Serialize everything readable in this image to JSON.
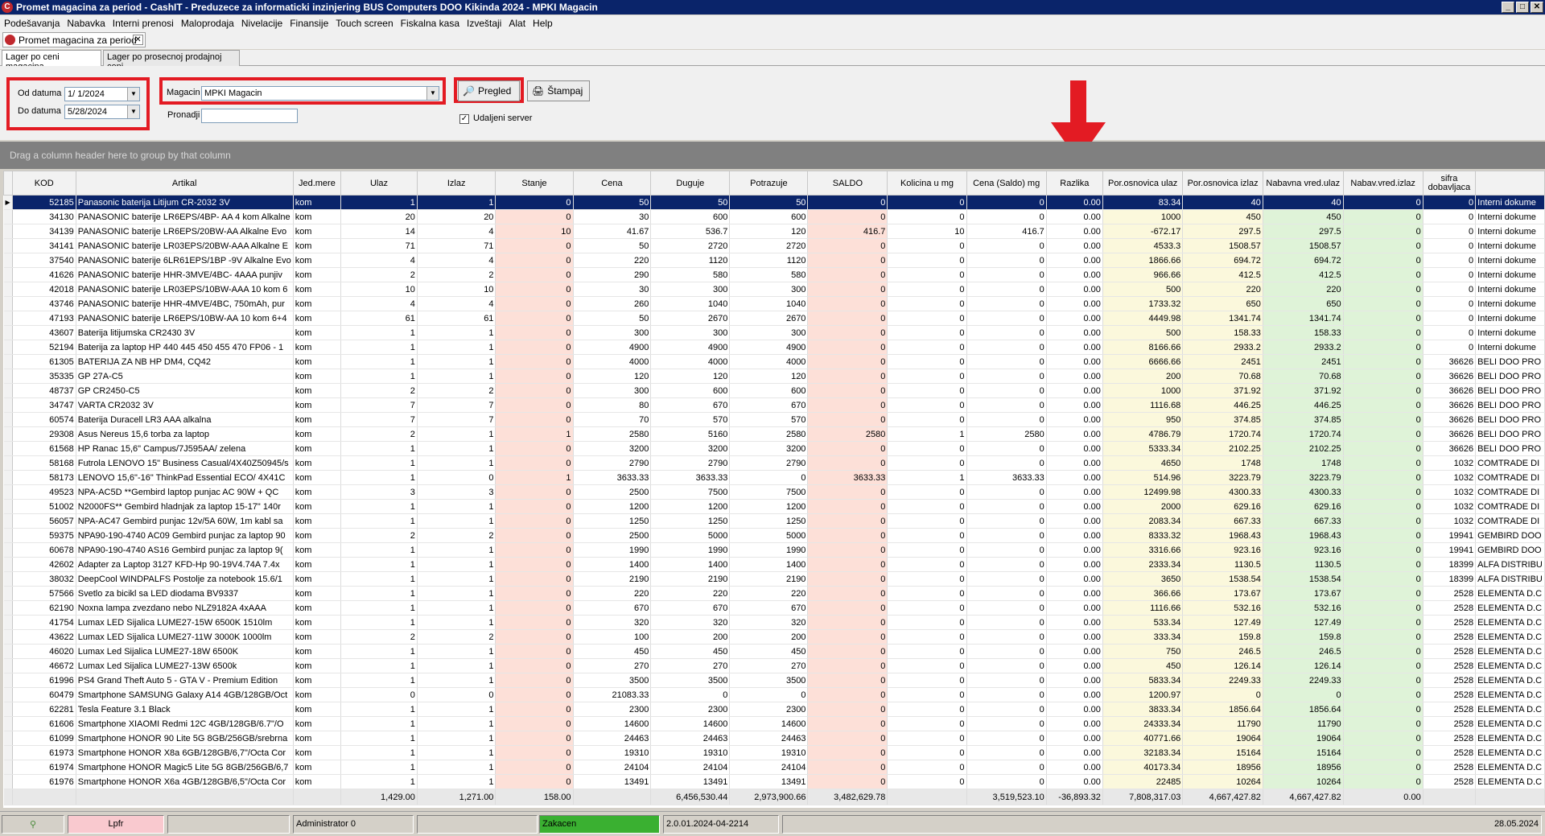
{
  "window": {
    "title": "Promet magacina za period - CashIT - Preduzece za informaticki inzinjering BUS Computers DOO Kikinda 2024 - MPKI Magacin"
  },
  "menu": [
    "Podešavanja",
    "Nabavka",
    "Interni prenosi",
    "Maloprodaja",
    "Nivelacije",
    "Finansije",
    "Touch screen",
    "Fiskalna kasa",
    "Izveštaji",
    "Alat",
    "Help"
  ],
  "doc_tab": {
    "label": "Promet magacina za period"
  },
  "sub_tabs": [
    "Lager po ceni magacina",
    "Lager po prosecnoj prodajnoj ceni"
  ],
  "filters": {
    "od_label": "Od datuma",
    "od_value": "1/  1/2024",
    "do_label": "Do datuma",
    "do_value": "5/28/2024",
    "magacin_label": "Magacin",
    "magacin_value": "MPKI Magacin",
    "pronadji_label": "Pronadji",
    "pronadji_value": "",
    "pregled_label": "Pregled",
    "stampaj_label": "Štampaj",
    "udaljeni_label": "Udaljeni server",
    "udaljeni_checked": true
  },
  "group_hint": "Drag a column header here to group by that column",
  "columns": [
    "KOD",
    "Artikal",
    "Jed.mere",
    "Ulaz",
    "Izlaz",
    "Stanje",
    "Cena",
    "Duguje",
    "Potrazuje",
    "SALDO",
    "Kolicina u mg",
    "Cena (Saldo) mg",
    "Razlika",
    "Por.osnovica ulaz",
    "Por.osnovica izlaz",
    "Nabavna vred.ulaz",
    "Nabav.vred.izlaz",
    "sifra dobavljaca",
    ""
  ],
  "rows": [
    [
      "52185",
      "Panasonic baterija Litijum CR-2032 3V",
      "kom",
      "1",
      "1",
      "0",
      "50",
      "50",
      "50",
      "0",
      "0",
      "0",
      "0.00",
      "83.34",
      "40",
      "40",
      "0",
      "0",
      "Interni dokume"
    ],
    [
      "34130",
      "PANASONIC baterije LR6EPS/4BP- AA 4 kom Alkalne",
      "kom",
      "20",
      "20",
      "0",
      "30",
      "600",
      "600",
      "0",
      "0",
      "0",
      "0.00",
      "1000",
      "450",
      "450",
      "0",
      "0",
      "Interni dokume"
    ],
    [
      "34139",
      "PANASONIC baterije LR6EPS/20BW-AA  Alkalne Evo",
      "kom",
      "14",
      "4",
      "10",
      "41.67",
      "536.7",
      "120",
      "416.7",
      "10",
      "416.7",
      "0.00",
      "-672.17",
      "297.5",
      "297.5",
      "0",
      "0",
      "Interni dokume"
    ],
    [
      "34141",
      "PANASONIC baterije LR03EPS/20BW-AAA  Alkalne E",
      "kom",
      "71",
      "71",
      "0",
      "50",
      "2720",
      "2720",
      "0",
      "0",
      "0",
      "0.00",
      "4533.3",
      "1508.57",
      "1508.57",
      "0",
      "0",
      "Interni dokume"
    ],
    [
      "37540",
      "PANASONIC baterije 6LR61EPS/1BP -9V Alkalne Evo",
      "kom",
      "4",
      "4",
      "0",
      "220",
      "1120",
      "1120",
      "0",
      "0",
      "0",
      "0.00",
      "1866.66",
      "694.72",
      "694.72",
      "0",
      "0",
      "Interni dokume"
    ],
    [
      "41626",
      "PANASONIC baterije HHR-3MVE/4BC- 4AAA punjiv",
      "kom",
      "2",
      "2",
      "0",
      "290",
      "580",
      "580",
      "0",
      "0",
      "0",
      "0.00",
      "966.66",
      "412.5",
      "412.5",
      "0",
      "0",
      "Interni dokume"
    ],
    [
      "42018",
      "PANASONIC baterije LR03EPS/10BW-AAA 10 kom 6",
      "kom",
      "10",
      "10",
      "0",
      "30",
      "300",
      "300",
      "0",
      "0",
      "0",
      "0.00",
      "500",
      "220",
      "220",
      "0",
      "0",
      "Interni dokume"
    ],
    [
      "43746",
      "PANASONIC baterije HHR-4MVE/4BC, 750mAh, pur",
      "kom",
      "4",
      "4",
      "0",
      "260",
      "1040",
      "1040",
      "0",
      "0",
      "0",
      "0.00",
      "1733.32",
      "650",
      "650",
      "0",
      "0",
      "Interni dokume"
    ],
    [
      "47193",
      "PANASONIC baterije LR6EPS/10BW-AA 10 kom 6+4",
      "kom",
      "61",
      "61",
      "0",
      "50",
      "2670",
      "2670",
      "0",
      "0",
      "0",
      "0.00",
      "4449.98",
      "1341.74",
      "1341.74",
      "0",
      "0",
      "Interni dokume"
    ],
    [
      "43607",
      "Baterija litijumska CR2430 3V",
      "kom",
      "1",
      "1",
      "0",
      "300",
      "300",
      "300",
      "0",
      "0",
      "0",
      "0.00",
      "500",
      "158.33",
      "158.33",
      "0",
      "0",
      "Interni dokume"
    ],
    [
      "52194",
      "Baterija za laptop HP 440 445 450 455 470 FP06 - 1",
      "kom",
      "1",
      "1",
      "0",
      "4900",
      "4900",
      "4900",
      "0",
      "0",
      "0",
      "0.00",
      "8166.66",
      "2933.2",
      "2933.2",
      "0",
      "0",
      "Interni dokume"
    ],
    [
      "61305",
      "BATERIJA ZA NB HP DM4, CQ42",
      "kom",
      "1",
      "1",
      "0",
      "4000",
      "4000",
      "4000",
      "0",
      "0",
      "0",
      "0.00",
      "6666.66",
      "2451",
      "2451",
      "0",
      "36626",
      "BELI DOO PRO"
    ],
    [
      "35335",
      "GP 27A-C5",
      "kom",
      "1",
      "1",
      "0",
      "120",
      "120",
      "120",
      "0",
      "0",
      "0",
      "0.00",
      "200",
      "70.68",
      "70.68",
      "0",
      "36626",
      "BELI DOO PRO"
    ],
    [
      "48737",
      "GP CR2450-C5",
      "kom",
      "2",
      "2",
      "0",
      "300",
      "600",
      "600",
      "0",
      "0",
      "0",
      "0.00",
      "1000",
      "371.92",
      "371.92",
      "0",
      "36626",
      "BELI DOO PRO"
    ],
    [
      "34747",
      "VARTA  CR2032 3V",
      "kom",
      "7",
      "7",
      "0",
      "80",
      "670",
      "670",
      "0",
      "0",
      "0",
      "0.00",
      "1116.68",
      "446.25",
      "446.25",
      "0",
      "36626",
      "BELI DOO PRO"
    ],
    [
      "60574",
      "Baterija Duracell LR3 AAA alkalna",
      "kom",
      "7",
      "7",
      "0",
      "70",
      "570",
      "570",
      "0",
      "0",
      "0",
      "0.00",
      "950",
      "374.85",
      "374.85",
      "0",
      "36626",
      "BELI DOO PRO"
    ],
    [
      "29308",
      "Asus Nereus 15,6 torba za laptop",
      "kom",
      "2",
      "1",
      "1",
      "2580",
      "5160",
      "2580",
      "2580",
      "1",
      "2580",
      "0.00",
      "4786.79",
      "1720.74",
      "1720.74",
      "0",
      "36626",
      "BELI DOO PRO"
    ],
    [
      "61568",
      "HP Ranac 15,6\" Campus/7J595AA/ zelena",
      "kom",
      "1",
      "1",
      "0",
      "3200",
      "3200",
      "3200",
      "0",
      "0",
      "0",
      "0.00",
      "5333.34",
      "2102.25",
      "2102.25",
      "0",
      "36626",
      "BELI DOO PRO"
    ],
    [
      "58168",
      "Futrola LENOVO 15\" Business Casual/4X40Z50945/s",
      "kom",
      "1",
      "1",
      "0",
      "2790",
      "2790",
      "2790",
      "0",
      "0",
      "0",
      "0.00",
      "4650",
      "1748",
      "1748",
      "0",
      "1032",
      "COMTRADE DI"
    ],
    [
      "58173",
      "LENOVO  15,6\"-16\" ThinkPad Essential ECO/ 4X41C",
      "kom",
      "1",
      "0",
      "1",
      "3633.33",
      "3633.33",
      "0",
      "3633.33",
      "1",
      "3633.33",
      "0.00",
      "514.96",
      "3223.79",
      "3223.79",
      "0",
      "1032",
      "COMTRADE DI"
    ],
    [
      "49523",
      "NPA-AC5D **Gembird laptop punjac AC 90W + QC",
      "kom",
      "3",
      "3",
      "0",
      "2500",
      "7500",
      "7500",
      "0",
      "0",
      "0",
      "0.00",
      "12499.98",
      "4300.33",
      "4300.33",
      "0",
      "1032",
      "COMTRADE DI"
    ],
    [
      "51002",
      "N2000FS** Gembird hladnjak za laptop 15-17\" 140r",
      "kom",
      "1",
      "1",
      "0",
      "1200",
      "1200",
      "1200",
      "0",
      "0",
      "0",
      "0.00",
      "2000",
      "629.16",
      "629.16",
      "0",
      "1032",
      "COMTRADE DI"
    ],
    [
      "56057",
      "NPA-AC47 Gembird punjac 12v/5A 60W, 1m kabl sa",
      "kom",
      "1",
      "1",
      "0",
      "1250",
      "1250",
      "1250",
      "0",
      "0",
      "0",
      "0.00",
      "2083.34",
      "667.33",
      "667.33",
      "0",
      "1032",
      "COMTRADE DI"
    ],
    [
      "59375",
      "NPA90-190-4740 AC09 Gembird punjac za laptop 90",
      "kom",
      "2",
      "2",
      "0",
      "2500",
      "5000",
      "5000",
      "0",
      "0",
      "0",
      "0.00",
      "8333.32",
      "1968.43",
      "1968.43",
      "0",
      "19941",
      "GEMBIRD DOO"
    ],
    [
      "60678",
      "NPA90-190-4740 AS16 Gembird punjac za laptop 9(",
      "kom",
      "1",
      "1",
      "0",
      "1990",
      "1990",
      "1990",
      "0",
      "0",
      "0",
      "0.00",
      "3316.66",
      "923.16",
      "923.16",
      "0",
      "19941",
      "GEMBIRD DOO"
    ],
    [
      "42602",
      "Adapter za Laptop 3127 KFD-Hp 90-19V4.74A 7.4x",
      "kom",
      "1",
      "1",
      "0",
      "1400",
      "1400",
      "1400",
      "0",
      "0",
      "0",
      "0.00",
      "2333.34",
      "1130.5",
      "1130.5",
      "0",
      "18399",
      "ALFA DISTRIBU"
    ],
    [
      "38032",
      "DeepCool WINDPALFS Postolje za notebook 15.6/1",
      "kom",
      "1",
      "1",
      "0",
      "2190",
      "2190",
      "2190",
      "0",
      "0",
      "0",
      "0.00",
      "3650",
      "1538.54",
      "1538.54",
      "0",
      "18399",
      "ALFA DISTRIBU"
    ],
    [
      "57566",
      "Svetlo za bicikl sa LED diodama BV9337",
      "kom",
      "1",
      "1",
      "0",
      "220",
      "220",
      "220",
      "0",
      "0",
      "0",
      "0.00",
      "366.66",
      "173.67",
      "173.67",
      "0",
      "2528",
      "ELEMENTA D.C"
    ],
    [
      "62190",
      "Noxna lampa zvezdano nebo NLZ9182A 4xAAA",
      "kom",
      "1",
      "1",
      "0",
      "670",
      "670",
      "670",
      "0",
      "0",
      "0",
      "0.00",
      "1116.66",
      "532.16",
      "532.16",
      "0",
      "2528",
      "ELEMENTA D.C"
    ],
    [
      "41754",
      "Lumax LED Sijalica LUME27-15W 6500K 1510lm",
      "kom",
      "1",
      "1",
      "0",
      "320",
      "320",
      "320",
      "0",
      "0",
      "0",
      "0.00",
      "533.34",
      "127.49",
      "127.49",
      "0",
      "2528",
      "ELEMENTA D.C"
    ],
    [
      "43622",
      "Lumax LED Sijalica LUME27-11W 3000K 1000lm",
      "kom",
      "2",
      "2",
      "0",
      "100",
      "200",
      "200",
      "0",
      "0",
      "0",
      "0.00",
      "333.34",
      "159.8",
      "159.8",
      "0",
      "2528",
      "ELEMENTA D.C"
    ],
    [
      "46020",
      "Lumax Led Sijalica LUME27-18W 6500K",
      "kom",
      "1",
      "1",
      "0",
      "450",
      "450",
      "450",
      "0",
      "0",
      "0",
      "0.00",
      "750",
      "246.5",
      "246.5",
      "0",
      "2528",
      "ELEMENTA D.C"
    ],
    [
      "46672",
      "Lumax Led Sijalica LUME27-13W 6500k",
      "kom",
      "1",
      "1",
      "0",
      "270",
      "270",
      "270",
      "0",
      "0",
      "0",
      "0.00",
      "450",
      "126.14",
      "126.14",
      "0",
      "2528",
      "ELEMENTA D.C"
    ],
    [
      "61996",
      "PS4 Grand Theft Auto 5 - GTA V - Premium Edition",
      "kom",
      "1",
      "1",
      "0",
      "3500",
      "3500",
      "3500",
      "0",
      "0",
      "0",
      "0.00",
      "5833.34",
      "2249.33",
      "2249.33",
      "0",
      "2528",
      "ELEMENTA D.C"
    ],
    [
      "60479",
      "Smartphone SAMSUNG Galaxy A14 4GB/128GB/Oct",
      "kom",
      "0",
      "0",
      "0",
      "21083.33",
      "0",
      "0",
      "0",
      "0",
      "0",
      "0.00",
      "1200.97",
      "0",
      "0",
      "0",
      "2528",
      "ELEMENTA D.C"
    ],
    [
      "62281",
      "Tesla Feature 3.1 Black",
      "kom",
      "1",
      "1",
      "0",
      "2300",
      "2300",
      "2300",
      "0",
      "0",
      "0",
      "0.00",
      "3833.34",
      "1856.64",
      "1856.64",
      "0",
      "2528",
      "ELEMENTA D.C"
    ],
    [
      "61606",
      "Smartphone XIAOMI Redmi 12C 4GB/128GB/6.7\"/O",
      "kom",
      "1",
      "1",
      "0",
      "14600",
      "14600",
      "14600",
      "0",
      "0",
      "0",
      "0.00",
      "24333.34",
      "11790",
      "11790",
      "0",
      "2528",
      "ELEMENTA D.C"
    ],
    [
      "61099",
      "Smartphone HONOR 90 Lite 5G 8GB/256GB/srebrna",
      "kom",
      "1",
      "1",
      "0",
      "24463",
      "24463",
      "24463",
      "0",
      "0",
      "0",
      "0.00",
      "40771.66",
      "19064",
      "19064",
      "0",
      "2528",
      "ELEMENTA D.C"
    ],
    [
      "61973",
      "Smartphone HONOR X8a 6GB/128GB/6,7\"/Octa Cor",
      "kom",
      "1",
      "1",
      "0",
      "19310",
      "19310",
      "19310",
      "0",
      "0",
      "0",
      "0.00",
      "32183.34",
      "15164",
      "15164",
      "0",
      "2528",
      "ELEMENTA D.C"
    ],
    [
      "61974",
      "Smartphone HONOR Magic5 Lite 5G 8GB/256GB/6,7",
      "kom",
      "1",
      "1",
      "0",
      "24104",
      "24104",
      "24104",
      "0",
      "0",
      "0",
      "0.00",
      "40173.34",
      "18956",
      "18956",
      "0",
      "2528",
      "ELEMENTA D.C"
    ],
    [
      "61976",
      "Smartphone HONOR X6a 4GB/128GB/6,5\"/Octa Cor",
      "kom",
      "1",
      "1",
      "0",
      "13491",
      "13491",
      "13491",
      "0",
      "0",
      "0",
      "0.00",
      "22485",
      "10264",
      "10264",
      "0",
      "2528",
      "ELEMENTA D.C"
    ]
  ],
  "totals": {
    "ulaz": "1,429.00",
    "izlaz": "1,271.00",
    "stanje": "158.00",
    "duguje": "6,456,530.44",
    "potrazuje": "2,973,900.66",
    "saldo": "3,482,629.78",
    "cena_saldo": "3,519,523.10",
    "razlika": "-36,893.32",
    "por_ulaz": "7,808,317.03",
    "por_izlaz": "4,667,427.82",
    "nab_ulaz": "4,667,427.82",
    "nab_izlaz": "0.00"
  },
  "status": {
    "lpfr": "Lpfr",
    "user": "Administrator 0",
    "zakacen": "Zakacen",
    "version": "2.0.01.2024-04-2214",
    "date": "28.05.2024"
  },
  "colors": {
    "accent_red": "#e31b23",
    "selection": "#0a246a",
    "zakacen_green": "#3ab031",
    "lpfr_pink": "#f9c9cf"
  }
}
